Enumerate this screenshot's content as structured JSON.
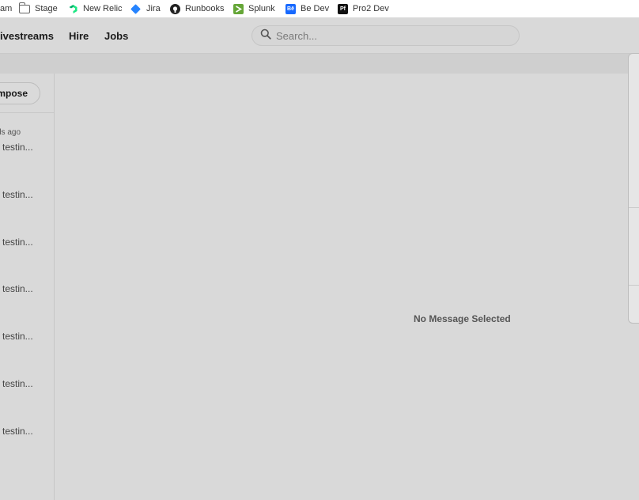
{
  "bookmarks": {
    "partial": "am",
    "items": [
      {
        "label": "Stage",
        "icon": "folder-icon"
      },
      {
        "label": "New Relic",
        "icon": "new-relic-icon"
      },
      {
        "label": "Jira",
        "icon": "jira-icon"
      },
      {
        "label": "Runbooks",
        "icon": "github-icon"
      },
      {
        "label": "Splunk",
        "icon": "splunk-icon"
      },
      {
        "label": "Be Dev",
        "icon": "behance-icon",
        "icon_text": "Bē"
      },
      {
        "label": "Pro2 Dev",
        "icon": "portfolio-icon",
        "icon_text": "Pf"
      }
    ]
  },
  "nav": {
    "livestreams": "ivestreams",
    "hire": "Hire",
    "jobs": "Jobs"
  },
  "search": {
    "placeholder": "Search...",
    "value": ""
  },
  "sidebar": {
    "compose_label": "mpose",
    "time_ago": "ds ago",
    "messages": [
      "testin...",
      "testin...",
      "testin...",
      "testin...",
      "testin...",
      "testin...",
      "testin..."
    ]
  },
  "main": {
    "empty_state": "No Message Selected"
  },
  "colors": {
    "background": "#d9d9d9",
    "bookmarks_bar": "#ffffff",
    "jira": "#2684ff",
    "new_relic": "#1ce783",
    "splunk": "#65a637",
    "behance": "#1769ff"
  }
}
